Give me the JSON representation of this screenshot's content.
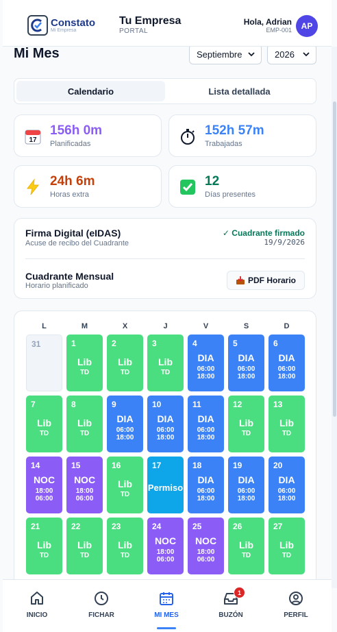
{
  "header": {
    "logo_name": "Constato",
    "logo_sub": "Mi Empresa",
    "company_name": "Tu Empresa",
    "company_sub": "PORTAL",
    "greeting": "Hola, Adrian",
    "employee_id": "EMP-001",
    "avatar_initials": "AP"
  },
  "page": {
    "title": "Mi Mes",
    "month": "Septiembre",
    "year": "2026"
  },
  "tabs": [
    {
      "label": "Calendario",
      "active": true
    },
    {
      "label": "Lista detallada",
      "active": false
    }
  ],
  "stats": [
    {
      "value": "156h 0m",
      "label": "Planificadas",
      "icon": "calendar-icon",
      "color": "#8b5cf6"
    },
    {
      "value": "152h 57m",
      "label": "Trabajadas",
      "icon": "stopwatch-icon",
      "color": "#3b82f6"
    },
    {
      "value": "24h 6m",
      "label": "Horas extra",
      "icon": "lightning-icon",
      "color": "#c2410c"
    },
    {
      "value": "12",
      "label": "Días presentes",
      "icon": "check-box-icon",
      "color": "#047857"
    }
  ],
  "signature": {
    "title": "Firma Digital (eIDAS)",
    "subtitle": "Acuse de recibo del Cuadrante",
    "status": "✓ Cuadrante firmado",
    "date": "19/9/2026",
    "monthly_title": "Cuadrante Mensual",
    "monthly_subtitle": "Horario planificado",
    "pdf_button": "PDF Horario"
  },
  "calendar": {
    "weekdays": [
      "L",
      "M",
      "X",
      "J",
      "V",
      "S",
      "D"
    ],
    "colors": {
      "lib": "#4ade80",
      "dia": "#3b82f6",
      "noc": "#8b5cf6",
      "perm": "#0ea5e9"
    },
    "days": [
      {
        "num": "31",
        "type": "empty"
      },
      {
        "num": "1",
        "type": "lib",
        "code": "Lib",
        "sub": "TD"
      },
      {
        "num": "2",
        "type": "lib",
        "code": "Lib",
        "sub": "TD"
      },
      {
        "num": "3",
        "type": "lib",
        "code": "Lib",
        "sub": "TD"
      },
      {
        "num": "4",
        "type": "dia",
        "code": "DIA",
        "start": "06:00",
        "end": "18:00"
      },
      {
        "num": "5",
        "type": "dia",
        "code": "DIA",
        "start": "06:00",
        "end": "18:00"
      },
      {
        "num": "6",
        "type": "dia",
        "code": "DIA",
        "start": "06:00",
        "end": "18:00"
      },
      {
        "num": "7",
        "type": "lib",
        "code": "Lib",
        "sub": "TD"
      },
      {
        "num": "8",
        "type": "lib",
        "code": "Lib",
        "sub": "TD"
      },
      {
        "num": "9",
        "type": "dia",
        "code": "DIA",
        "start": "06:00",
        "end": "18:00"
      },
      {
        "num": "10",
        "type": "dia",
        "code": "DIA",
        "start": "06:00",
        "end": "18:00"
      },
      {
        "num": "11",
        "type": "dia",
        "code": "DIA",
        "start": "06:00",
        "end": "18:00"
      },
      {
        "num": "12",
        "type": "lib",
        "code": "Lib",
        "sub": "TD"
      },
      {
        "num": "13",
        "type": "lib",
        "code": "Lib",
        "sub": "TD"
      },
      {
        "num": "14",
        "type": "noc",
        "code": "NOC",
        "start": "18:00",
        "end": "06:00"
      },
      {
        "num": "15",
        "type": "noc",
        "code": "NOC",
        "start": "18:00",
        "end": "06:00"
      },
      {
        "num": "16",
        "type": "lib",
        "code": "Lib",
        "sub": "TD"
      },
      {
        "num": "17",
        "type": "perm",
        "code": "Permiso"
      },
      {
        "num": "18",
        "type": "dia",
        "code": "DIA",
        "start": "06:00",
        "end": "18:00"
      },
      {
        "num": "19",
        "type": "dia",
        "code": "DIA",
        "start": "06:00",
        "end": "18:00"
      },
      {
        "num": "20",
        "type": "dia",
        "code": "DIA",
        "start": "06:00",
        "end": "18:00"
      },
      {
        "num": "21",
        "type": "lib",
        "code": "Lib",
        "sub": "TD"
      },
      {
        "num": "22",
        "type": "lib",
        "code": "Lib",
        "sub": "TD"
      },
      {
        "num": "23",
        "type": "lib",
        "code": "Lib",
        "sub": "TD"
      },
      {
        "num": "24",
        "type": "noc",
        "code": "NOC",
        "start": "18:00",
        "end": "06:00"
      },
      {
        "num": "25",
        "type": "noc",
        "code": "NOC",
        "start": "18:00",
        "end": "06:00"
      },
      {
        "num": "26",
        "type": "lib",
        "code": "Lib",
        "sub": "TD"
      },
      {
        "num": "27",
        "type": "lib",
        "code": "Lib",
        "sub": "TD"
      }
    ]
  },
  "nav": [
    {
      "label": "INICIO",
      "icon": "home-icon",
      "active": false
    },
    {
      "label": "FICHAR",
      "icon": "clock-icon",
      "active": false
    },
    {
      "label": "MI MES",
      "icon": "calendar-icon",
      "active": true
    },
    {
      "label": "BUZÓN",
      "icon": "inbox-icon",
      "active": false,
      "badge": "1"
    },
    {
      "label": "PERFIL",
      "icon": "user-circle-icon",
      "active": false
    }
  ]
}
